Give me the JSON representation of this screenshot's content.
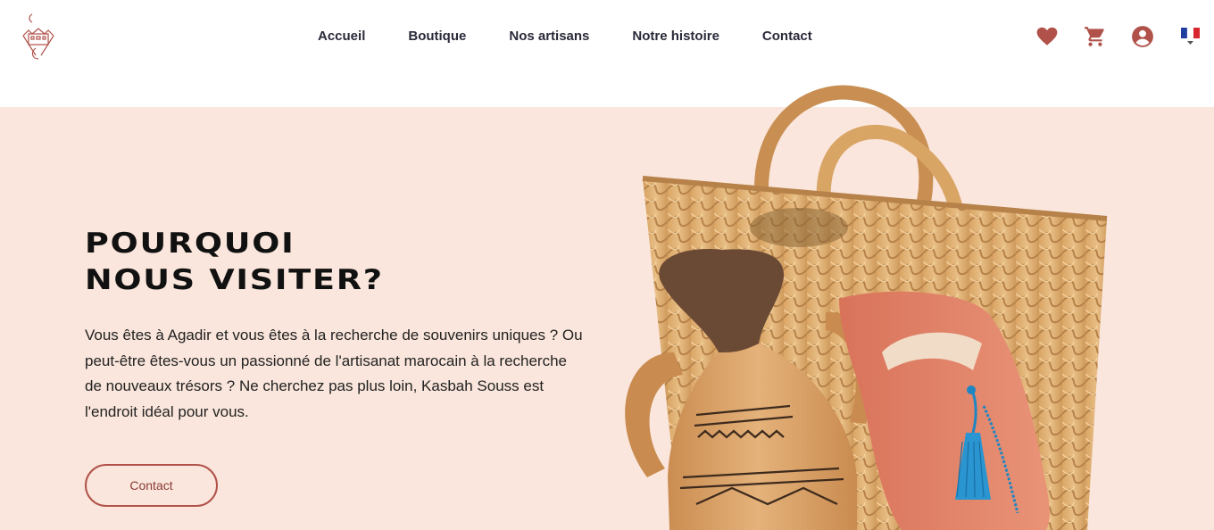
{
  "brand": {
    "logo_icon": "kasbah-logo-icon"
  },
  "nav": {
    "items": [
      {
        "label": "Accueil"
      },
      {
        "label": "Boutique"
      },
      {
        "label": "Nos artisans"
      },
      {
        "label": "Notre histoire"
      },
      {
        "label": "Contact"
      }
    ]
  },
  "header_icons": {
    "heart": "heart-icon",
    "cart": "cart-icon",
    "user": "user-icon",
    "language": "french-flag-icon",
    "accent_color": "#b0524a"
  },
  "hero": {
    "title_line1": "POURQUOI",
    "title_line2": "NOUS VISITER?",
    "text": "Vous êtes à Agadir et vous êtes à la recherche de souvenirs uniques ? Ou peut-être êtes-vous un passionné de l'artisanat marocain à la recherche de nouveaux trésors ? Ne cherchez pas plus loin, Kasbah Souss est l'endroit idéal pour vous.",
    "cta_label": "Contact",
    "background_color": "#fae6dc"
  }
}
